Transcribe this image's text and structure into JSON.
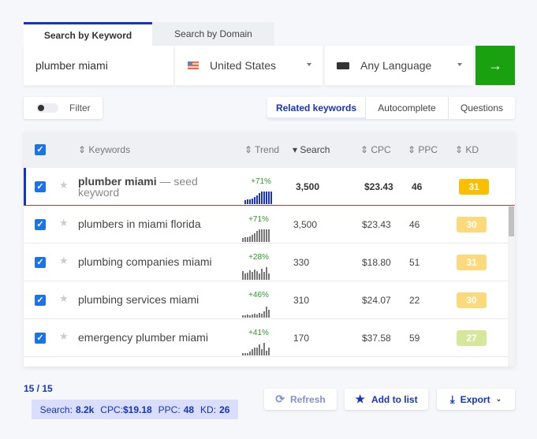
{
  "tabs": {
    "keyword": "Search by Keyword",
    "domain": "Search by Domain"
  },
  "search": {
    "query": "plumber miami",
    "country": "United States",
    "language": "Any Language",
    "go_icon": "arrow-right-icon"
  },
  "filter": {
    "label": "Filter",
    "enabled": false
  },
  "modes": {
    "related": "Related keywords",
    "autocomplete": "Autocomplete",
    "questions": "Questions",
    "active": "related"
  },
  "columns": {
    "keywords": "Keywords",
    "trend": "Trend",
    "search": "Search",
    "cpc": "CPC",
    "ppc": "PPC",
    "kd": "KD"
  },
  "rows": [
    {
      "keyword": "plumber miami",
      "suffix": "— seed keyword",
      "trend_pct": "+71%",
      "trend": [
        0.3,
        0.35,
        0.4,
        0.45,
        0.55,
        0.7,
        0.85,
        1,
        1,
        1,
        1,
        1
      ],
      "search": "3,500",
      "cpc": "$23.43",
      "ppc": "46",
      "kd": "31",
      "kd_color": "#fbbf00",
      "seed": true
    },
    {
      "keyword": "plumbers in miami florida",
      "trend_pct": "+71%",
      "trend": [
        0.3,
        0.35,
        0.4,
        0.45,
        0.55,
        0.7,
        0.85,
        1,
        1,
        1,
        1,
        1
      ],
      "search": "3,500",
      "cpc": "$23.43",
      "ppc": "46",
      "kd": "30",
      "kd_color": "#fcd97a"
    },
    {
      "keyword": "plumbing companies miami",
      "trend_pct": "+28%",
      "trend": [
        0.7,
        0.5,
        0.55,
        0.75,
        0.6,
        0.8,
        0.7,
        0.5,
        0.85,
        0.6,
        1,
        0.5
      ],
      "search": "330",
      "cpc": "$18.80",
      "ppc": "51",
      "kd": "31",
      "kd_color": "#fcd97a"
    },
    {
      "keyword": "plumbing services miami",
      "trend_pct": "+46%",
      "trend": [
        0.2,
        0.2,
        0.25,
        0.2,
        0.25,
        0.3,
        0.25,
        0.35,
        0.3,
        0.5,
        0.9,
        0.6
      ],
      "search": "310",
      "cpc": "$24.07",
      "ppc": "22",
      "kd": "30",
      "kd_color": "#fcd97a"
    },
    {
      "keyword": "emergency plumber miami",
      "trend_pct": "+41%",
      "trend": [
        0.2,
        0.2,
        0.2,
        0.3,
        0.5,
        0.6,
        0.6,
        0.9,
        0.5,
        1,
        0.4,
        0.6
      ],
      "search": "170",
      "cpc": "$37.58",
      "ppc": "59",
      "kd": "27",
      "kd_color": "#d5e89a"
    }
  ],
  "footer": {
    "count": "15 / 15",
    "stats": {
      "search_label": "Search:",
      "search": "8.2k",
      "cpc_label": "CPC:",
      "cpc": "$19.18",
      "ppc_label": "PPC:",
      "ppc": "48",
      "kd_label": "KD:",
      "kd": "26"
    }
  },
  "actions": {
    "refresh": "Refresh",
    "add": "Add to list",
    "export": "Export"
  },
  "colors": {
    "accent": "#1533c4",
    "go": "#1aa10f",
    "checkbox": "#1a73e8"
  }
}
